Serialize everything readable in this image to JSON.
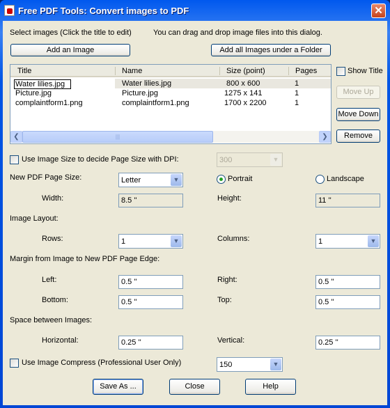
{
  "window": {
    "title": "Free PDF Tools: Convert images to PDF",
    "close_icon": "close-icon",
    "app_icon": "pdf-tools-icon"
  },
  "header": {
    "select_label": "Select images (Click the title to edit)",
    "drag_hint": "You can drag and drop image files into this dialog.",
    "add_image": "Add an Image",
    "add_folder": "Add all Images under a Folder"
  },
  "list": {
    "columns": [
      "Title",
      "Name",
      "Size (point)",
      "Pages"
    ],
    "rows": [
      {
        "title": "Water lilies.jpg",
        "name": "Water lilies.jpg",
        "size": "800 x  600",
        "pages": "1"
      },
      {
        "title": "Picture.jpg",
        "name": "Picture.jpg",
        "size": "1275 x  141",
        "pages": "1"
      },
      {
        "title": "complaintform1.png",
        "name": "complaintform1.png",
        "size": "1700 x 2200",
        "pages": "1"
      }
    ],
    "selected_row": 0
  },
  "side": {
    "show_title": "Show Title",
    "show_title_checked": false,
    "move_up": "Move Up",
    "move_down": "Move Down",
    "remove": "Remove"
  },
  "dpi": {
    "label": "Use Image Size to decide Page Size with DPI:",
    "checked": false,
    "value": "300"
  },
  "page": {
    "label": "New PDF Page Size:",
    "size": "Letter",
    "portrait": "Portrait",
    "landscape": "Landscape",
    "orientation": "Portrait",
    "width_label": "Width:",
    "width": "8.5 ''",
    "height_label": "Height:",
    "height": "11 ''"
  },
  "layout": {
    "label": "Image Layout:",
    "rows_label": "Rows:",
    "rows": "1",
    "columns_label": "Columns:",
    "columns": "1"
  },
  "margin": {
    "label": "Margin from Image to New PDF Page Edge:",
    "left_label": "Left:",
    "left": "0.5 ''",
    "right_label": "Right:",
    "right": "0.5 ''",
    "bottom_label": "Bottom:",
    "bottom": "0.5 ''",
    "top_label": "Top:",
    "top": "0.5 ''"
  },
  "space": {
    "label": "Space between Images:",
    "horizontal_label": "Horizontal:",
    "horizontal": "0.25 ''",
    "vertical_label": "Vertical:",
    "vertical": "0.25 ''"
  },
  "compress": {
    "label": "Use Image Compress  (Professional User Only)",
    "checked": false,
    "value": "150"
  },
  "footer": {
    "save_as": "Save As ...",
    "close": "Close",
    "help": "Help"
  }
}
